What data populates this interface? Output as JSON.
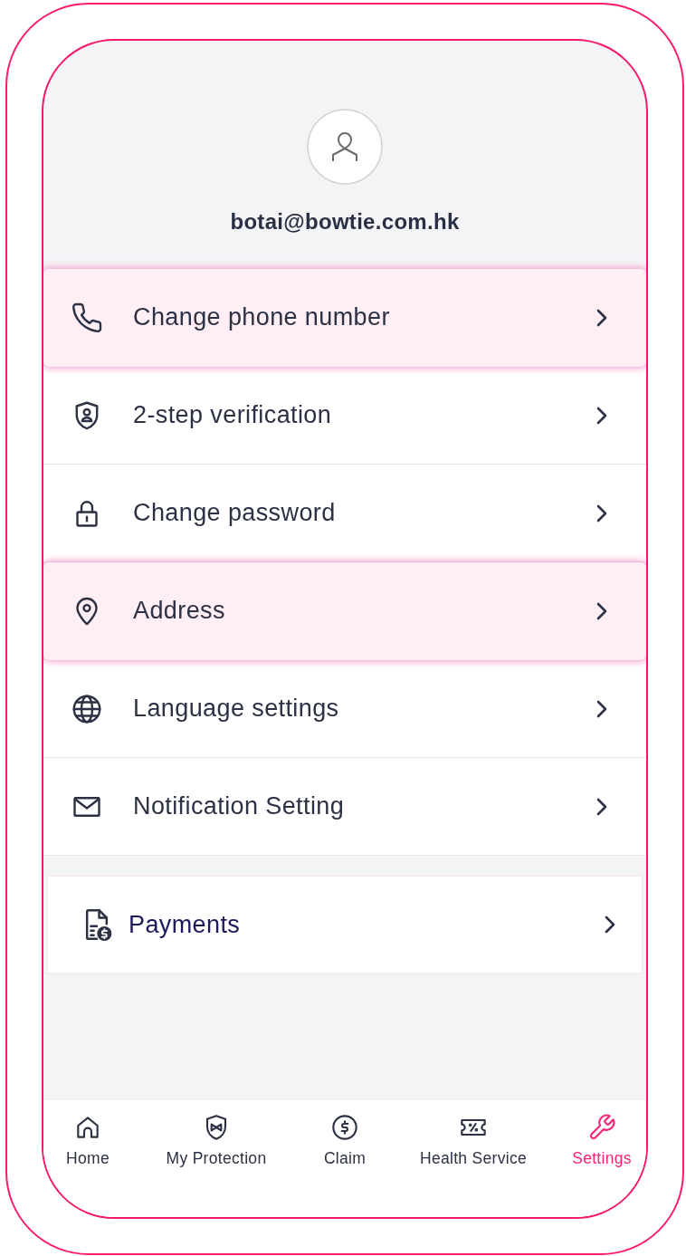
{
  "profile": {
    "email": "botai@bowtie.com.hk"
  },
  "menu": [
    {
      "label": "Change phone number",
      "highlighted": true
    },
    {
      "label": "2-step verification",
      "highlighted": false
    },
    {
      "label": "Change password",
      "highlighted": false
    },
    {
      "label": "Address",
      "highlighted": true
    },
    {
      "label": "Language settings",
      "highlighted": false
    },
    {
      "label": "Notification Setting",
      "highlighted": false
    }
  ],
  "payments": {
    "label": "Payments"
  },
  "tab_bar": [
    {
      "label": "Home",
      "selected": false
    },
    {
      "label": "My Protection",
      "selected": false
    },
    {
      "label": "Claim",
      "selected": false
    },
    {
      "label": "Health Service",
      "selected": false
    },
    {
      "label": "Settings",
      "selected": true
    }
  ]
}
